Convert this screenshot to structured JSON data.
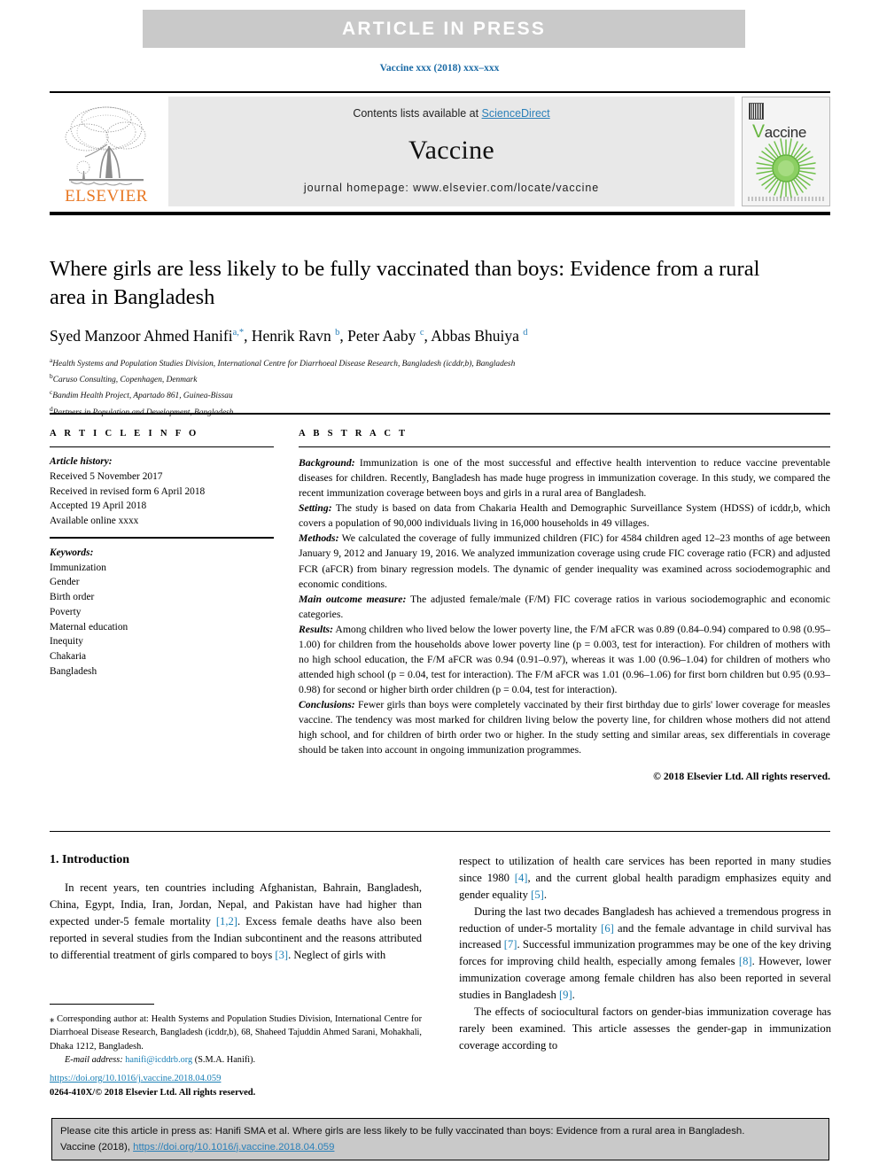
{
  "banner": {
    "text": "ARTICLE IN PRESS"
  },
  "journal_ref": "Vaccine xxx (2018) xxx–xxx",
  "masthead": {
    "contents_prefix": "Contents lists available at ",
    "sciencedirect": "ScienceDirect",
    "journal_name": "Vaccine",
    "homepage": "journal homepage: www.elsevier.com/locate/vaccine",
    "publisher": "ELSEVIER",
    "cover_title_first": "V",
    "cover_title_rest": "accine"
  },
  "article": {
    "title": "Where girls are less likely to be fully vaccinated than boys: Evidence from a rural area in Bangladesh",
    "authors_html": "Syed Manzoor Ahmed Hanifi<sup class=\"a\">a,<span class=\"star\">*</span></sup>, Henrik Ravn <sup>b</sup>, Peter Aaby <sup>c</sup>, Abbas Bhuiya <sup>d</sup>",
    "affiliations": [
      {
        "mark": "a",
        "text": "Health Systems and Population Studies Division, International Centre for Diarrhoeal Disease Research, Bangladesh (icddr,b), Bangladesh"
      },
      {
        "mark": "b",
        "text": "Caruso Consulting, Copenhagen, Denmark"
      },
      {
        "mark": "c",
        "text": "Bandim Health Project, Apartado 861, Guinea-Bissau"
      },
      {
        "mark": "d",
        "text": "Partners in Population and Development, Bangladesh"
      }
    ]
  },
  "article_info": {
    "heading": "A R T I C L E   I N F O",
    "history_label": "Article history:",
    "history": [
      "Received 5 November 2017",
      "Received in revised form 6 April 2018",
      "Accepted 19 April 2018",
      "Available online xxxx"
    ],
    "keywords_label": "Keywords:",
    "keywords": [
      "Immunization",
      "Gender",
      "Birth order",
      "Poverty",
      "Maternal education",
      "Inequity",
      "Chakaria",
      "Bangladesh"
    ]
  },
  "abstract": {
    "heading": "A B S T R A C T",
    "sections": [
      {
        "label": "Background:",
        "text": " Immunization is one of the most successful and effective health intervention to reduce vaccine preventable diseases for children. Recently, Bangladesh has made huge progress in immunization coverage. In this study, we compared the recent immunization coverage between boys and girls in a rural area of Bangladesh."
      },
      {
        "label": "Setting:",
        "text": " The study is based on data from Chakaria Health and Demographic Surveillance System (HDSS) of icddr,b, which covers a population of 90,000 individuals living in 16,000 households in 49 villages."
      },
      {
        "label": "Methods:",
        "text": " We calculated the coverage of fully immunized children (FIC) for 4584 children aged 12–23 months of age between January 9, 2012 and January 19, 2016. We analyzed immunization coverage using crude FIC coverage ratio (FCR) and adjusted FCR (aFCR) from binary regression models. The dynamic of gender inequality was examined across sociodemographic and economic conditions."
      },
      {
        "label": "Main outcome measure:",
        "text": " The adjusted female/male (F/M) FIC coverage ratios in various sociodemographic and economic categories."
      },
      {
        "label": "Results:",
        "text": " Among children who lived below the lower poverty line, the F/M aFCR was 0.89 (0.84–0.94) compared to 0.98 (0.95–1.00) for children from the households above lower poverty line (p = 0.003, test for interaction). For children of mothers with no high school education, the F/M aFCR was 0.94 (0.91–0.97), whereas it was 1.00 (0.96–1.04) for children of mothers who attended high school (p = 0.04, test for interaction). The F/M aFCR was 1.01 (0.96–1.06) for first born children but 0.95 (0.93–0.98) for second or higher birth order children (p = 0.04, test for interaction)."
      },
      {
        "label": "Conclusions:",
        "text": " Fewer girls than boys were completely vaccinated by their first birthday due to girls' lower coverage for measles vaccine. The tendency was most marked for children living below the poverty line, for children whose mothers did not attend high school, and for children of birth order two or higher. In the study setting and similar areas, sex differentials in coverage should be taken into account in ongoing immunization programmes."
      }
    ],
    "copyright": "© 2018 Elsevier Ltd. All rights reserved."
  },
  "body": {
    "section_heading": "1. Introduction",
    "left_paragraphs": [
      "In recent years, ten countries including Afghanistan, Bahrain, Bangladesh, China, Egypt, India, Iran, Jordan, Nepal, and Pakistan have had higher than expected under-5 female mortality <span class=\"ref\">[1,2]</span>. Excess female deaths have also been reported in several studies from the Indian subcontinent and the reasons attributed to differential treatment of girls compared to boys <span class=\"ref\">[3]</span>. Neglect of girls with"
    ],
    "right_paragraphs": [
      "respect to utilization of health care services has been reported in many studies since 1980 <span class=\"ref\">[4]</span>, and the current global health paradigm emphasizes equity and gender equality <span class=\"ref\">[5]</span>.",
      "During the last two decades Bangladesh has achieved a tremendous progress in reduction of under-5 mortality <span class=\"ref\">[6]</span> and the female advantage in child survival has increased <span class=\"ref\">[7]</span>. Successful immunization programmes may be one of the key driving forces for improving child health, especially among females <span class=\"ref\">[8]</span>. However, lower immunization coverage among female children has also been reported in several studies in Bangladesh <span class=\"ref\">[9]</span>.",
      "The effects of sociocultural factors on gender-bias immunization coverage has rarely been examined. This article assesses the gender-gap in immunization coverage according to"
    ]
  },
  "footnote": {
    "corresponding": "⁎ Corresponding author at: Health Systems and Population Studies Division, International Centre for Diarrhoeal Disease Research, Bangladesh (icddr,b), 68, Shaheed Tajuddin Ahmed Sarani, Mohakhali, Dhaka 1212, Bangladesh.",
    "email_label": "E-mail address:",
    "email": "hanifi@icddrb.org",
    "email_suffix": " (S.M.A. Hanifi)."
  },
  "doi_block": {
    "doi": "https://doi.org/10.1016/j.vaccine.2018.04.059",
    "issn": "0264-410X/© 2018 Elsevier Ltd. All rights reserved."
  },
  "citation_box": {
    "line1": "Please cite this article in press as: Hanifi SMA et al. Where girls are less likely to be fully vaccinated than boys: Evidence from a rural area in Bangladesh.",
    "line2_prefix": "Vaccine (2018), ",
    "line2_link": "https://doi.org/10.1016/j.vaccine.2018.04.059"
  },
  "colors": {
    "banner_bg": "#c9c9c9",
    "link_blue": "#1a7fb5",
    "elsevier_orange": "#e87722",
    "masthead_gray": "#e8e8e8",
    "cover_green": "#67b540"
  }
}
